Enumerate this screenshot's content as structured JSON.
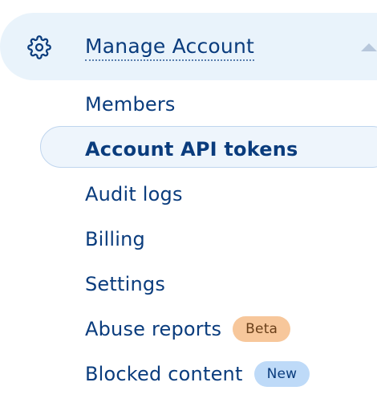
{
  "section": {
    "label": "Manage Account",
    "icon": "gear-icon",
    "caret_icon": "chevron-up-icon"
  },
  "items": [
    {
      "label": "Members",
      "active": false
    },
    {
      "label": "Account API tokens",
      "active": true
    },
    {
      "label": "Audit logs",
      "active": false
    },
    {
      "label": "Billing",
      "active": false
    },
    {
      "label": "Settings",
      "active": false
    },
    {
      "label": "Abuse reports",
      "active": false,
      "badge": "Beta"
    },
    {
      "label": "Blocked content",
      "active": false,
      "badge": "New"
    }
  ],
  "colors": {
    "text": "#0a3c7d",
    "header_bg": "#e9f3fb",
    "active_bg": "#eef5fc",
    "active_border": "#bfd5ee",
    "beta_badge_bg": "#f7c79b",
    "new_badge_bg": "#bedaf8"
  }
}
